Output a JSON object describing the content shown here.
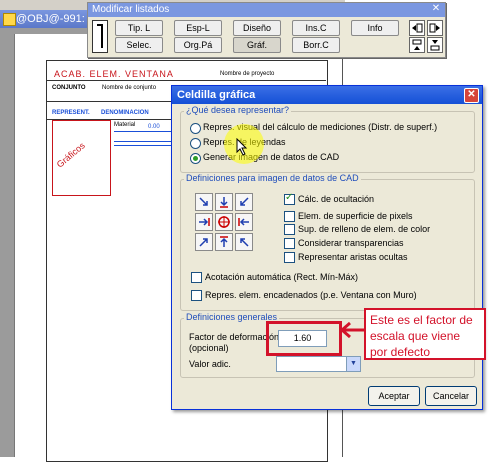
{
  "bg_window": {
    "title": "@OBJ@-991:",
    "sheet": {
      "title": "ACAB. ELEM. VENTANA",
      "proj_label": "Nombre de proyecto",
      "conj_label": "CONJUNTO",
      "conj_value": "Nombre de conjunto",
      "repr_label": "REPRESENT.",
      "denom_label": "DENOMINACION",
      "graf_label": "Gráficos",
      "mat_label": "Material",
      "mat_value": "0.00"
    }
  },
  "toolbar": {
    "title": "Modificar listados",
    "buttons_row1": [
      "Tip. L",
      "Esp-L",
      "Diseño",
      "Ins.C",
      "Info"
    ],
    "buttons_row2": [
      "Selec.",
      "Org.Pá",
      "Gráf.",
      "Borr.C"
    ],
    "pressed_button": "Gráf."
  },
  "dialog": {
    "title": "Celdilla gráfica",
    "section1": {
      "legend": "¿Qué desea representar?",
      "options": [
        "Repres. visual del cálculo de mediciones (Distr. de superf.)",
        "Repres. de leyendas",
        "Generar imagen de datos de CAD"
      ],
      "selected_index": 2
    },
    "section2": {
      "legend": "Definiciones para imagen de datos de CAD",
      "checks": [
        {
          "label": "Cálc. de ocultación",
          "checked": true
        },
        {
          "label": "Elem. de superficie de pixels",
          "checked": false
        },
        {
          "label": "Sup. de relleno de elem. de color",
          "checked": false
        },
        {
          "label": "Considerar transparencias",
          "checked": false
        },
        {
          "label": "Representar aristas ocultas",
          "checked": false
        }
      ],
      "bottom_checks": [
        {
          "label": "Acotación automática (Rect. Mín-Máx)",
          "checked": false
        },
        {
          "label": "Repres. elem. encadenados (p.e. Ventana con Muro)",
          "checked": false
        }
      ],
      "direction_icons": [
        "arrow-se-icon",
        "arrow-s-icon",
        "arrow-sw-icon",
        "arrow-e-icon",
        "target-icon",
        "arrow-w-icon",
        "arrow-ne-icon",
        "arrow-n-icon",
        "arrow-nw-icon"
      ]
    },
    "section3": {
      "legend": "Definiciones generales",
      "factor_label": "Factor de deformación",
      "factor_sub": "(opcional)",
      "factor_value": "1.60",
      "valor_label": "Valor adic.",
      "valor_value": ""
    },
    "accept_label": "Aceptar",
    "cancel_label": "Cancelar"
  },
  "annotation": {
    "text": "Este es el factor de escala que viene por defecto",
    "color": "#d3122a"
  }
}
